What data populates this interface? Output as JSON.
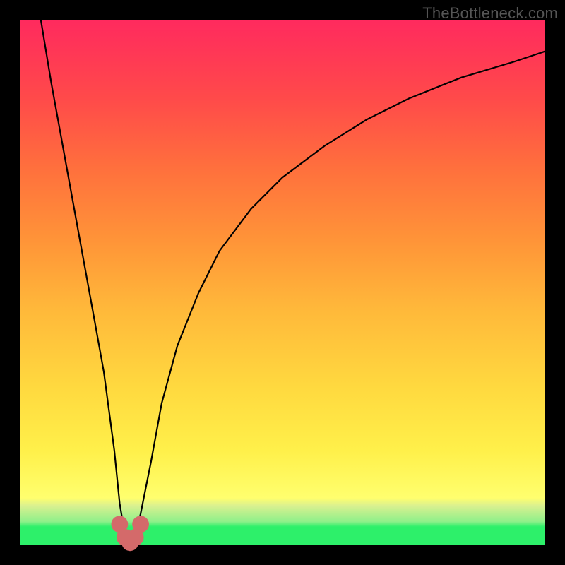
{
  "watermark": "TheBottleneck.com",
  "chart_data": {
    "type": "line",
    "title": "",
    "xlabel": "",
    "ylabel": "",
    "xlim": [
      0,
      100
    ],
    "ylim": [
      0,
      100
    ],
    "grid": false,
    "legend": false,
    "series": [
      {
        "name": "bottleneck-curve",
        "x": [
          4,
          6,
          8,
          10,
          12,
          14,
          16,
          18,
          19,
          20,
          21,
          22,
          23,
          25,
          27,
          30,
          34,
          38,
          44,
          50,
          58,
          66,
          74,
          84,
          94,
          100
        ],
        "y": [
          100,
          88,
          77,
          66,
          55,
          44,
          33,
          18,
          8,
          2,
          0,
          2,
          6,
          16,
          27,
          38,
          48,
          56,
          64,
          70,
          76,
          81,
          85,
          89,
          92,
          94
        ],
        "color": "#000000"
      }
    ],
    "markers": [
      {
        "name": "highlight-dot",
        "x": 19,
        "y": 4,
        "r": 1.6,
        "color": "#d46a6a"
      },
      {
        "name": "highlight-dot",
        "x": 20,
        "y": 1.5,
        "r": 1.6,
        "color": "#d46a6a"
      },
      {
        "name": "highlight-dot",
        "x": 21,
        "y": 0.5,
        "r": 1.6,
        "color": "#d46a6a"
      },
      {
        "name": "highlight-dot",
        "x": 22,
        "y": 1.5,
        "r": 1.6,
        "color": "#d46a6a"
      },
      {
        "name": "highlight-dot",
        "x": 23,
        "y": 4,
        "r": 1.6,
        "color": "#d46a6a"
      }
    ],
    "background_gradient": {
      "top": "#ff2a5e",
      "middle": "#fff04a",
      "bottom": "#2df06a"
    }
  }
}
